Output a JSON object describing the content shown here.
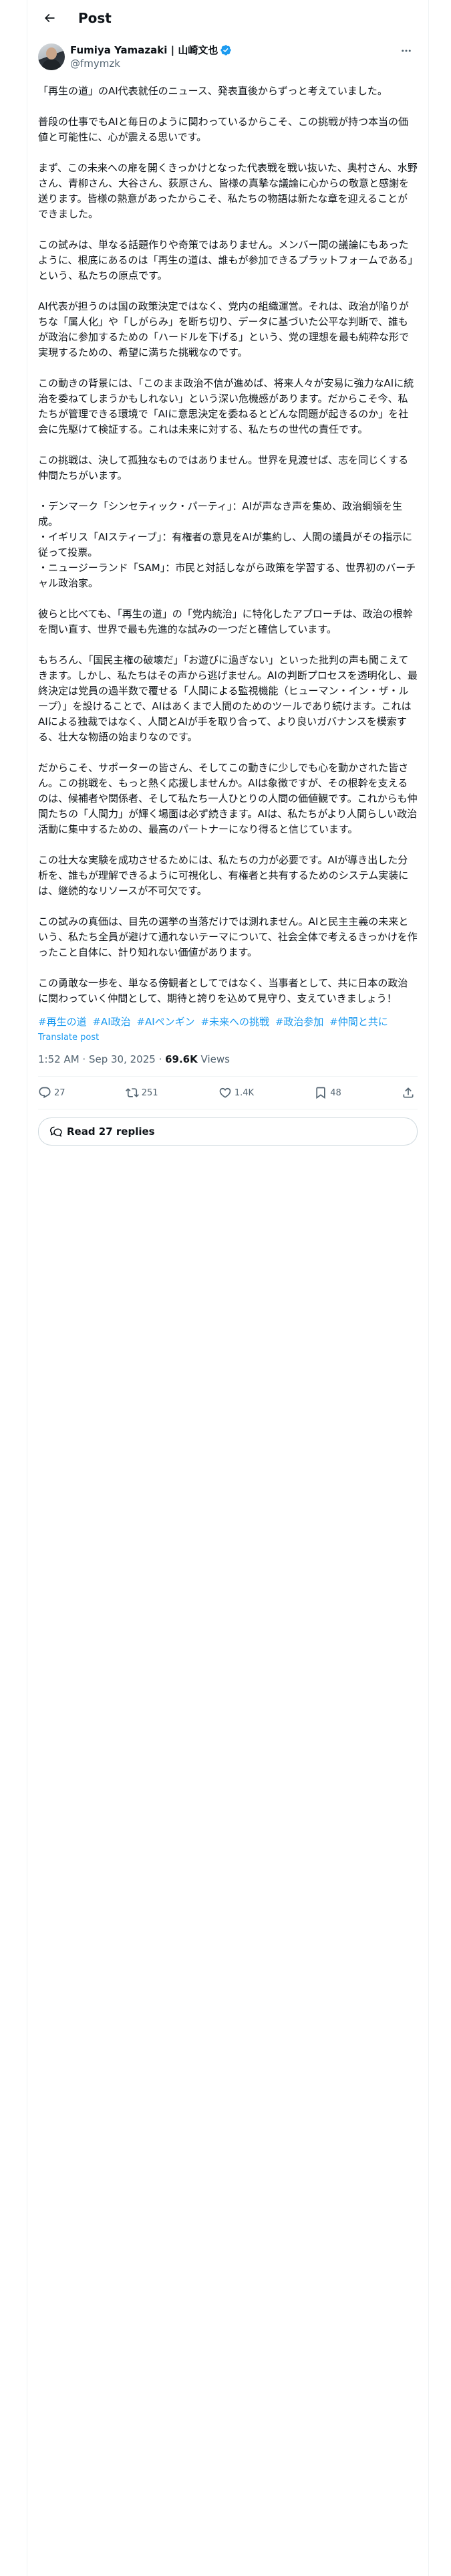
{
  "header": {
    "title": "Post"
  },
  "author": {
    "name": "Fumiya Yamazaki | 山崎文也",
    "handle": "@fmymzk"
  },
  "post": {
    "paragraphs": [
      "「再生の道」のAI代表就任のニュース、発表直後からずっと考えていました。",
      "普段の仕事でもAIと毎日のように関わっているからこそ、この挑戦が持つ本当の価値と可能性に、心が震える思いです。",
      "まず、この未来への扉を開くきっかけとなった代表戦を戦い抜いた、奥村さん、水野さん、青柳さん、大谷さん、荻原さん、皆様の真摯な議論に心からの敬意と感謝を送ります。皆様の熱意があったからこそ、私たちの物語は新たな章を迎えることができました。",
      "この試みは、単なる話題作りや奇策ではありません。メンバー間の議論にもあったように、根底にあるのは「再生の道は、誰もが参加できるプラットフォームである」という、私たちの原点です。",
      "AI代表が担うのは国の政策決定ではなく、党内の組織運営。それは、政治が陥りがちな「属人化」や「しがらみ」を断ち切り、データに基づいた公平な判断で、誰もが政治に参加するための「ハードルを下げる」という、党の理想を最も純粋な形で実現するための、希望に満ちた挑戦なのです。",
      "この動きの背景には、「このまま政治不信が進めば、将来人々が安易に強力なAIに統治を委ねてしまうかもしれない」という深い危機感があります。だからこそ今、私たちが管理できる環境で「AIに意思決定を委ねるとどんな問題が起きるのか」を社会に先駆けて検証する。これは未来に対する、私たちの世代の責任です。",
      "この挑戦は、決して孤独なものではありません。世界を見渡せば、志を同じくする仲間たちがいます。",
      "・デンマーク「シンセティック・パーティ」：AIが声なき声を集め、政治綱領を生成。\n・イギリス「AIスティーブ」：有権者の意見をAIが集約し、人間の議員がその指示に従って投票。\n・ニュージーランド「SAM」：市民と対話しながら政策を学習する、世界初のバーチャル政治家。",
      "彼らと比べても、「再生の道」の「党内統治」に特化したアプローチは、政治の根幹を問い直す、世界で最も先進的な試みの一つだと確信しています。",
      "もちろん、「国民主権の破壊だ」「お遊びに過ぎない」といった批判の声も聞こえてきます。しかし、私たちはその声から逃げません。AIの判断プロセスを透明化し、最終決定は党員の過半数で覆せる「人間による監視機能（ヒューマン・イン・ザ・ループ）」を設けることで、AIはあくまで人間のためのツールであり続けます。これはAIによる独裁ではなく、人間とAIが手を取り合って、より良いガバナンスを模索する、壮大な物語の始まりなのです。",
      "だからこそ、サポーターの皆さん、そしてこの動きに少しでも心を動かされた皆さん。この挑戦を、もっと熱く応援しませんか。AIは象徴ですが、その根幹を支えるのは、候補者や関係者、そして私たち一人ひとりの人間の価値観です。これからも仲間たちの「人間力」が輝く場面は必ず続きます。AIは、私たちがより人間らしい政治活動に集中するための、最高のパートナーになり得ると信じています。",
      "この壮大な実験を成功させるためには、私たちの力が必要です。AIが導き出した分析を、誰もが理解できるように可視化し、有権者と共有するためのシステム実装には、継続的なリソースが不可欠です。",
      "この試みの真価は、目先の選挙の当落だけでは測れません。AIと民主主義の未来という、私たち全員が避けて通れないテーマについて、社会全体で考えるきっかけを作ったこと自体に、計り知れない価値があります。",
      "この勇敢な一歩を、単なる傍観者としてではなく、当事者として、共に日本の政治に関わっていく仲間として、期待と誇りを込めて見守り、支えていきましょう！"
    ],
    "hashtags": [
      "#再生の道",
      "#AI政治",
      "#AIペンギン",
      "#未来への挑戦",
      "#政治参加",
      "#仲間と共に"
    ],
    "translate_label": "Translate post",
    "timestamp": "1:52 AM · Sep 30, 2025 · ",
    "views_count": "69.6K",
    "views_label": " Views"
  },
  "actions": {
    "replies": "27",
    "reposts": "251",
    "likes": "1.4K",
    "bookmarks": "48"
  },
  "read_replies_label": "Read 27 replies",
  "colors": {
    "accent": "#1d9bf0",
    "secondary_text": "#536471",
    "border": "#eff3f4"
  }
}
